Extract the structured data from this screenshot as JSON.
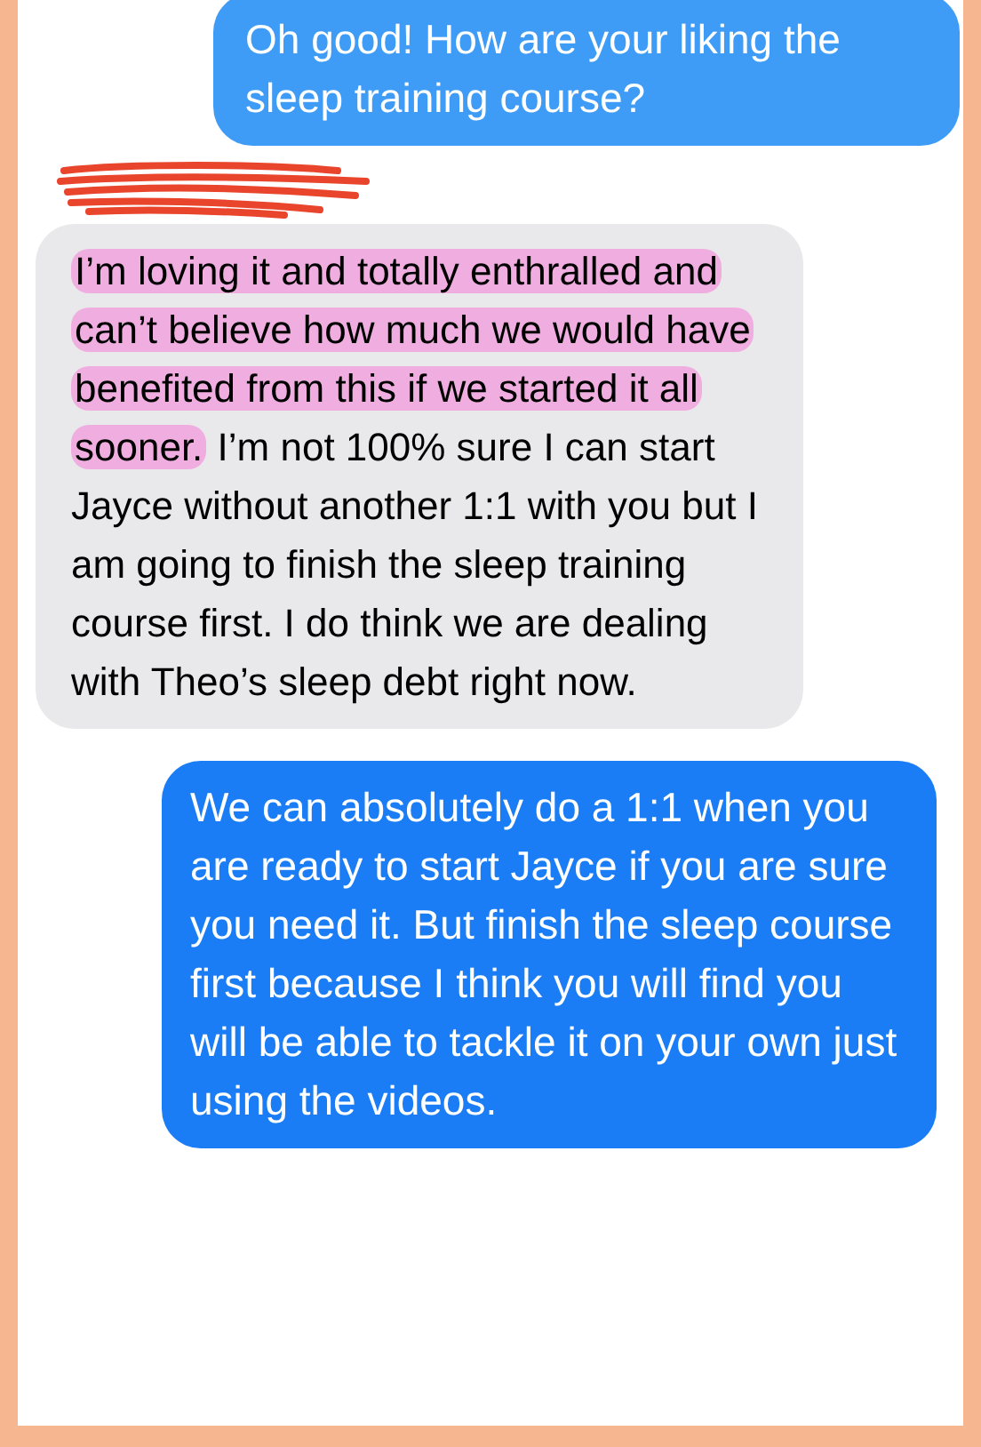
{
  "messages": [
    {
      "kind": "sent",
      "text": "Oh good! How are your liking the sleep training course?"
    },
    {
      "kind": "received",
      "redacted_sender": true,
      "segments": [
        {
          "text": "I’m loving it and totally enthralled and can’t believe how much we would have benefited from this if we started it all sooner.",
          "highlighted": true
        },
        {
          "text": " I’m not 100% sure I can start Jayce without another 1:1 with you but I am going to finish the sleep training course first.  I do think we are dealing with Theo’s sleep debt right now.",
          "highlighted": false
        }
      ]
    },
    {
      "kind": "sent",
      "text": "We can absolutely do a 1:1 when you are ready to start Jayce if you are sure you need it. But finish the sleep course first because I think you will find you will be able to tackle it on your own just using the videos."
    }
  ]
}
